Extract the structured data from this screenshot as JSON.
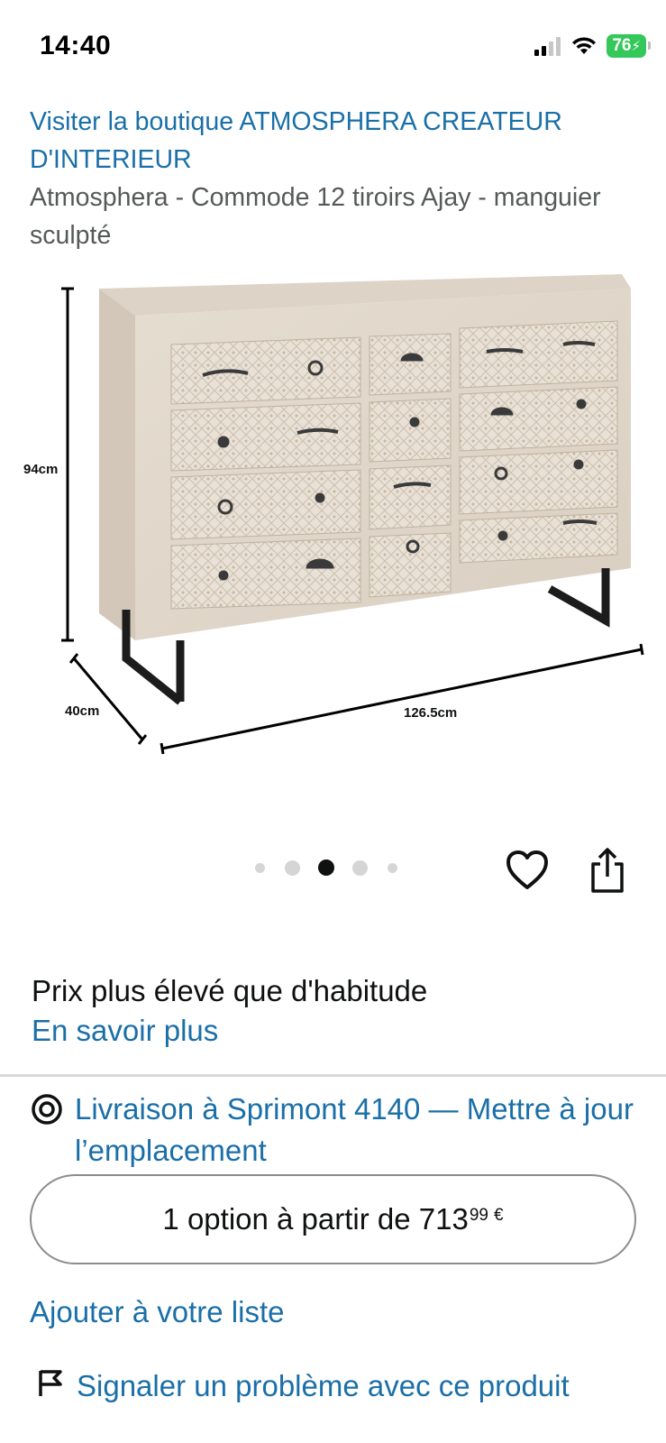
{
  "status_bar": {
    "time": "14:40",
    "battery": "76",
    "icons": [
      "cellular-signal-icon",
      "wifi-icon",
      "battery-charging-icon"
    ]
  },
  "header": {
    "store_link": "Visiter la boutique ATMOSPHERA CREATEUR D'INTERIEUR",
    "product_title": "Atmosphera - Commode 12 tiroirs Ajay - manguier sculpté"
  },
  "image": {
    "dimension_height": "94cm",
    "dimension_depth": "40cm",
    "dimension_width": "126.5cm",
    "carousel_dots": 5,
    "active_dot": 2
  },
  "price_notice": {
    "text": "Prix plus élevé que d'habitude",
    "link": "En savoir plus"
  },
  "delivery": {
    "text": "Livraison à Sprimont 4140 — Mettre à jour l’emplacement"
  },
  "options": {
    "label": "1 option à partir de 713",
    "price_cents": "99",
    "currency": "€"
  },
  "actions": {
    "add_to_list": "Ajouter à votre liste",
    "report_problem": "Signaler un problème avec ce produit"
  },
  "colors": {
    "link": "#1a6fa8",
    "text": "#0f1111",
    "secondary_text": "#565959",
    "battery": "#34c759"
  }
}
